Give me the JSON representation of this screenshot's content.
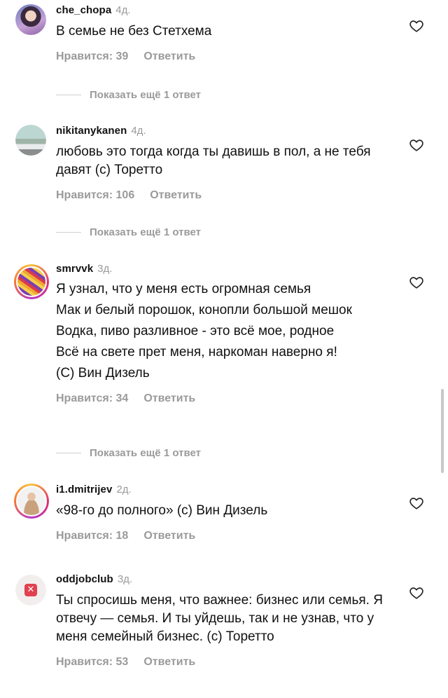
{
  "comments": [
    {
      "username": "che_chopa",
      "age": "4д.",
      "lines": [
        "В семье не без Стетхема"
      ],
      "likes": "Нравится: 39",
      "reply": "Ответить",
      "avatar_icon": "user-avatar-photo"
    },
    {
      "username": "nikitanykanen",
      "age": "4д.",
      "lines": [
        "любовь это тогда когда ты давишь в пол, а не тебя давят (с) Торетто"
      ],
      "likes": "Нравится: 106",
      "reply": "Ответить",
      "avatar_icon": "car-avatar-photo"
    },
    {
      "username": "smrvvk",
      "age": "3д.",
      "lines": [
        "Я узнал, что у меня есть огромная семья",
        "Мак и белый порошок, конопли большой мешок",
        "Водка, пиво разливное - это всё мое, родное",
        "Всё на свете прет меня, наркоман наверно я!",
        "(С) Вин Дизель"
      ],
      "likes": "Нравится: 34",
      "reply": "Ответить",
      "avatar_icon": "abstract-avatar-photo"
    },
    {
      "username": "i1.dmitrijev",
      "age": "2д.",
      "lines": [
        "«98-го до полного» (с) Вин Дизель"
      ],
      "likes": "Нравится: 18",
      "reply": "Ответить",
      "avatar_icon": "person-avatar-photo"
    },
    {
      "username": "oddjobclub",
      "age": "3д.",
      "lines": [
        "Ты спросишь меня, что важнее: бизнес или семья. Я отвечу — семья. И ты уйдешь, так и не узнав, что у меня семейный бизнес. (с) Торетто"
      ],
      "likes": "Нравится: 53",
      "reply": "Ответить",
      "avatar_icon": "logo-avatar"
    }
  ],
  "show_more": [
    "Показать ещё 1 ответ",
    "Показать ещё 1 ответ",
    "Показать ещё 1 ответ"
  ],
  "colors": {
    "text": "#111111",
    "muted": "#9a9a9a",
    "story_ring": "#e1306c"
  }
}
